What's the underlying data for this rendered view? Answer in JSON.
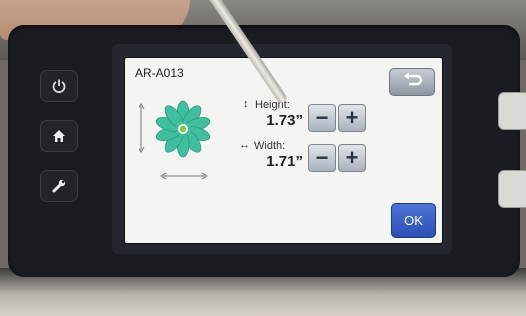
{
  "screen": {
    "pattern_code": "AR-A013",
    "height": {
      "label": "Height:",
      "value": "1.73”"
    },
    "width": {
      "label": "Width:",
      "value": "1.71”"
    },
    "decrease_symbol": "−",
    "increase_symbol": "+",
    "ok_label": "OK"
  },
  "icons": {
    "power": "power-icon",
    "home": "home-icon",
    "settings": "wrench-icon",
    "back": "back-arrow-icon",
    "height_glyph": "vertical-resize-icon",
    "width_glyph": "horizontal-resize-icon"
  },
  "colors": {
    "flower": "#3fbf9d",
    "ok_button": "#2f55c4",
    "screen_bg": "#f4f5f3"
  }
}
